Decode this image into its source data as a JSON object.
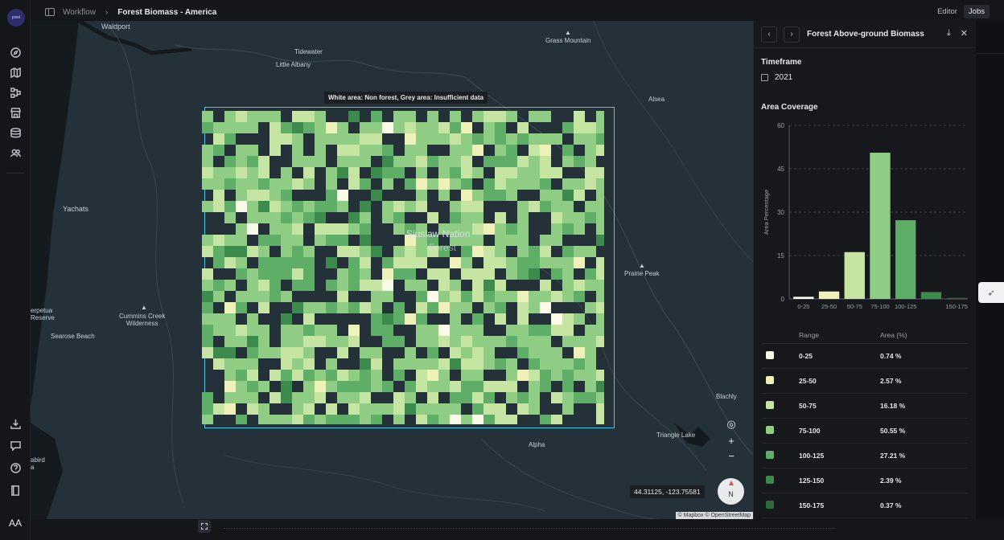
{
  "app": {
    "logo_text": "pixel",
    "avatar_initials": "AA"
  },
  "breadcrumb": {
    "root": "Workflow",
    "separator": "›",
    "current": "Forest Biomass - America"
  },
  "modes": {
    "editor": "Editor",
    "jobs": "Jobs",
    "active": "Jobs"
  },
  "sidebar": {
    "icons": [
      "compass-icon",
      "map-icon",
      "workflow-icon",
      "store-icon",
      "database-icon",
      "team-icon"
    ],
    "bottom_icons": [
      "download-icon",
      "chat-icon",
      "help-icon",
      "book-icon"
    ]
  },
  "map": {
    "tooltip": "White area: Non forest, Grey area: Insufficient data",
    "places": {
      "waldport": "Waldport",
      "tidewater": "Tidewater",
      "little_albany": "Little Albany",
      "grass_mountain": "Grass Mountain",
      "alsea": "Alsea",
      "yachats": "Yachats",
      "siuslaw": "Siuslaw Nation",
      "siuslaw2": "Forest",
      "prairie_peak": "Prairie Peak",
      "cummins_creek": "Cummins Creek\nWilderness",
      "searose": "Searose Beach",
      "perpetua": "erpetua\nReserve",
      "blachly": "Blachly",
      "triangle_lake": "Triangle Lake",
      "alpha": "Alpha",
      "seabird": "abird\na"
    },
    "coordinates": "44.31125, -123.75581",
    "attribution": "© Mapbox © OpenStreetMap",
    "compass_label": "N",
    "zoom_in": "+",
    "zoom_out": "−",
    "locate": "◎"
  },
  "panel": {
    "title": "Forest Above-ground Biomass",
    "timeframe_label": "Timeframe",
    "timeframe_value": "2021",
    "coverage_label": "Area Coverage",
    "table_headers": {
      "range": "Range",
      "area": "Area (%)"
    },
    "rows": [
      {
        "range": "0-25",
        "area": "0.74 %",
        "color": "#fafbe8"
      },
      {
        "range": "25-50",
        "area": "2.57 %",
        "color": "#eef2b8"
      },
      {
        "range": "50-75",
        "area": "16.18 %",
        "color": "#c6e5a2"
      },
      {
        "range": "75-100",
        "area": "50.55 %",
        "color": "#8fcc84"
      },
      {
        "range": "100-125",
        "area": "27.21 %",
        "color": "#5fae68"
      },
      {
        "range": "125-150",
        "area": "2.39 %",
        "color": "#3c8a4c"
      },
      {
        "range": "150-175",
        "area": "0.37 %",
        "color": "#2c6a3a"
      }
    ]
  },
  "chart_data": {
    "type": "bar",
    "categories": [
      "0-25",
      "25-50",
      "50-75",
      "75-100",
      "100-125",
      "125-150",
      "150-175"
    ],
    "tick_labels": [
      "0-25",
      "25-50",
      "50-75",
      "75-100",
      "100-125",
      "",
      "150-175"
    ],
    "values": [
      0.74,
      2.57,
      16.18,
      50.55,
      27.21,
      2.39,
      0.37
    ],
    "colors": [
      "#fafbe8",
      "#eef2b8",
      "#c6e5a2",
      "#8fcc84",
      "#5fae68",
      "#3c8a4c",
      "#2c6a3a"
    ],
    "title": "Area Coverage",
    "xlabel": "",
    "ylabel": "Area Percentage",
    "ylim": [
      0,
      60
    ],
    "yticks": [
      0,
      15,
      30,
      45,
      60
    ],
    "grid": true
  }
}
